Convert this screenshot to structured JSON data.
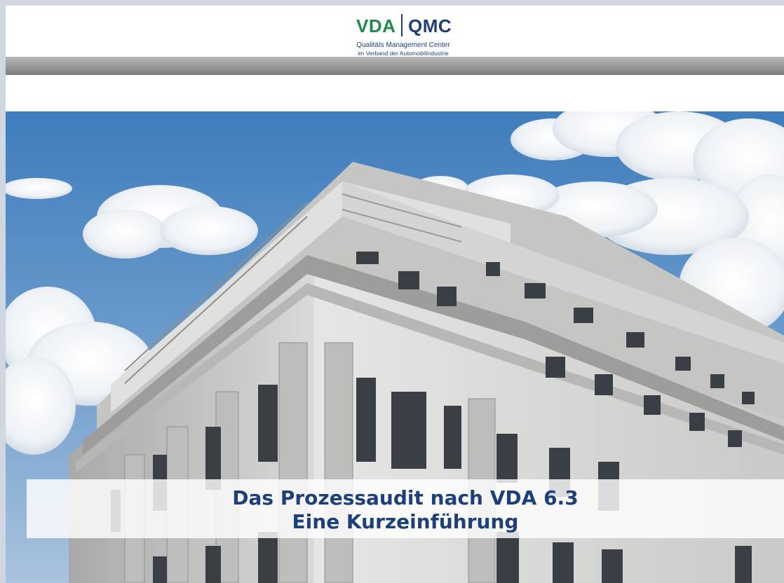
{
  "logo": {
    "vda": "VDA",
    "qmc": "QMC",
    "subtitle_line1": "Qualitäts Management Center",
    "subtitle_line2": "im Verband der Automobilindustrie"
  },
  "title": {
    "line1": "Das Prozessaudit nach VDA 6.3",
    "line2": "Eine Kurzeinführung"
  },
  "colors": {
    "vda_green": "#1f8a4c",
    "brand_blue": "#1e3f7a",
    "sky": "#4b86c2"
  }
}
